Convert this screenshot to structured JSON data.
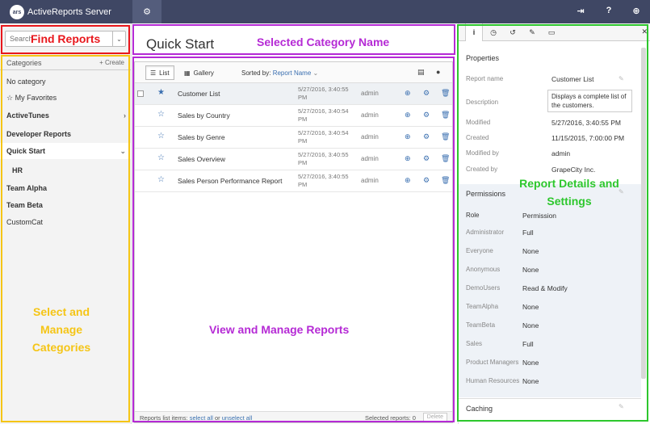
{
  "app": {
    "logo_mark": "ars",
    "title": "ActiveReports Server"
  },
  "topbar": {
    "icons": [
      "gears-icon",
      "logout-icon",
      "help-icon",
      "globe-icon"
    ],
    "help_label": "?"
  },
  "search": {
    "placeholder": "Search"
  },
  "categories": {
    "title": "Categories",
    "create_label": "+ Create",
    "items": [
      {
        "label": "No category",
        "bold": false
      },
      {
        "label": "☆ My Favorites",
        "bold": false
      },
      {
        "label": "ActiveTunes",
        "bold": true
      },
      {
        "label": "Developer Reports",
        "bold": true
      },
      {
        "label": "Quick Start",
        "bold": true
      },
      {
        "label": "HR",
        "bold": true
      },
      {
        "label": "Team Alpha",
        "bold": true
      },
      {
        "label": "Team Beta",
        "bold": true
      },
      {
        "label": "CustomCat",
        "bold": false
      }
    ]
  },
  "center": {
    "title": "Quick Start",
    "toolbar": {
      "list_label": "List",
      "gallery_label": "Gallery",
      "sorted_by_label": "Sorted by:",
      "sorted_by_value": "Report Name"
    },
    "reports": [
      {
        "name": "Customer List",
        "date": "5/27/2016, 3:40:55 PM",
        "user": "admin",
        "favorite": true
      },
      {
        "name": "Sales by Country",
        "date": "5/27/2016, 3:40:54 PM",
        "user": "admin",
        "favorite": false
      },
      {
        "name": "Sales by Genre",
        "date": "5/27/2016, 3:40:54 PM",
        "user": "admin",
        "favorite": false
      },
      {
        "name": "Sales Overview",
        "date": "5/27/2016, 3:40:55 PM",
        "user": "admin",
        "favorite": false
      },
      {
        "name": "Sales Person Performance Report",
        "date": "5/27/2016, 3:40:55 PM",
        "user": "admin",
        "favorite": false
      }
    ],
    "footer": {
      "items_label": "Reports list items:",
      "select_all": "select all",
      "or_label": "or",
      "unselect_all": "unselect all",
      "selected_label": "Selected reports: 0",
      "delete_label": "Delete"
    }
  },
  "details": {
    "properties_title": "Properties",
    "properties": {
      "report_name_label": "Report name",
      "report_name_value": "Customer List",
      "description_label": "Description",
      "description_value": "Displays a complete list of the customers.",
      "modified_label": "Modified",
      "modified_value": "5/27/2016, 3:40:55 PM",
      "created_label": "Created",
      "created_value": "11/15/2015, 7:00:00 PM",
      "modified_by_label": "Modified by",
      "modified_by_value": "admin",
      "created_by_label": "Created by",
      "created_by_value": "GrapeCity Inc."
    },
    "permissions_title": "Permissions",
    "role_header": "Role",
    "permission_header": "Permission",
    "permissions": [
      {
        "role": "Administrator",
        "permission": "Full"
      },
      {
        "role": "Everyone",
        "permission": "None"
      },
      {
        "role": "Anonymous",
        "permission": "None"
      },
      {
        "role": "DemoUsers",
        "permission": "Read & Modify"
      },
      {
        "role": "TeamAlpha",
        "permission": "None"
      },
      {
        "role": "TeamBeta",
        "permission": "None"
      },
      {
        "role": "Sales",
        "permission": "Full"
      },
      {
        "role": "Product Managers",
        "permission": "None"
      },
      {
        "role": "Human Resources",
        "permission": "None"
      }
    ],
    "caching_title": "Caching"
  },
  "annotations": {
    "find_reports": "Find Reports",
    "selected_category_name": "Selected Category Name",
    "view_manage_reports": "View and Manage Reports",
    "select_manage_categories": "Select and Manage Categories",
    "report_details": "Report Details and Settings"
  },
  "colors": {
    "topbar": "#3f4764",
    "accent": "#3a6fb0",
    "annotation_red": "#e8171c",
    "annotation_yellow": "#f5c516",
    "annotation_purple": "#b52ad5",
    "annotation_green": "#2dc72d"
  }
}
